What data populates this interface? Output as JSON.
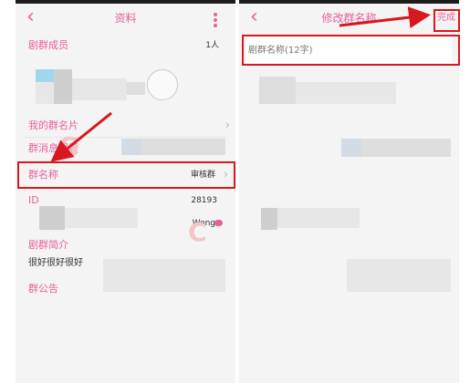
{
  "left": {
    "nav": {
      "title": "资料"
    },
    "rows": {
      "members_label": "剧群成员",
      "members_count": "1人",
      "my_card_label": "我的群名片",
      "block_label": "群消息屏蔽",
      "group_name_label": "群名称",
      "group_name_value": "审核群",
      "id_label": "ID",
      "id_value": "28193",
      "owner_name": "Weng",
      "intro_label": "剧群简介",
      "intro_text": "很好很好很好",
      "notice_label": "群公告"
    }
  },
  "right": {
    "nav": {
      "title": "修改群名称",
      "done_label": "完成"
    },
    "input": {
      "placeholder": "剧群名称(12字)"
    }
  },
  "colors": {
    "accent": "#e9609a",
    "highlight": "#d7181e"
  },
  "icons": {
    "back": "chevron-left-icon",
    "more": "more-vertical-icon",
    "row_arrow": "chevron-right-icon",
    "badge": "cloud-icon"
  }
}
